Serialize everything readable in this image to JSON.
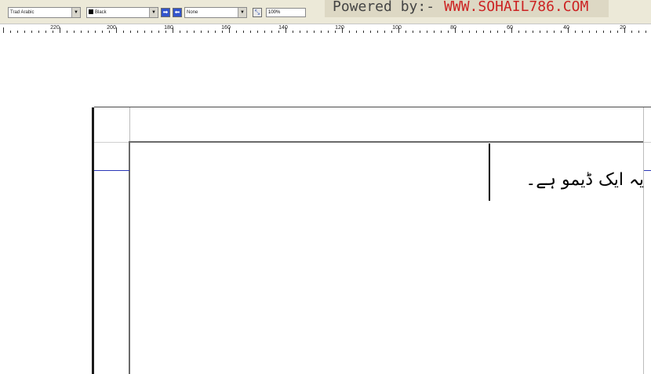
{
  "toolbar": {
    "font_name": "Trad Arabic",
    "color_name": "Black",
    "tint": "None",
    "zoom": "100%"
  },
  "banner": {
    "powered_by": "Powered by:-",
    "url": "WWW.SOHAIL786.COM"
  },
  "ruler": {
    "labels": [
      "220",
      "200",
      "180",
      "160",
      "140",
      "120",
      "100",
      "80",
      "60",
      "40",
      "20"
    ]
  },
  "document": {
    "text": "یہ ایک ڈیمو ہے۔"
  }
}
